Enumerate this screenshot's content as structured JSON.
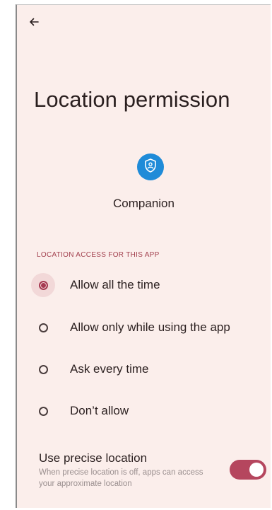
{
  "header": {
    "back_icon": "arrow-left-icon"
  },
  "page": {
    "title": "Location permission"
  },
  "app": {
    "name": "Companion",
    "icon": "shield-person-icon",
    "icon_color": "#1f8bd8"
  },
  "section": {
    "header": "LOCATION ACCESS FOR THIS APP"
  },
  "options": [
    {
      "label": "Allow all the time",
      "selected": true
    },
    {
      "label": "Allow only while using the app",
      "selected": false
    },
    {
      "label": "Ask every time",
      "selected": false
    },
    {
      "label": "Don’t allow",
      "selected": false
    }
  ],
  "precise": {
    "title": "Use precise location",
    "subtitle": "When precise location is off, apps can access your approximate location",
    "enabled": true
  },
  "colors": {
    "background": "#fbeeeb",
    "accent": "#a63a52",
    "toggle_track": "#b5465e"
  }
}
